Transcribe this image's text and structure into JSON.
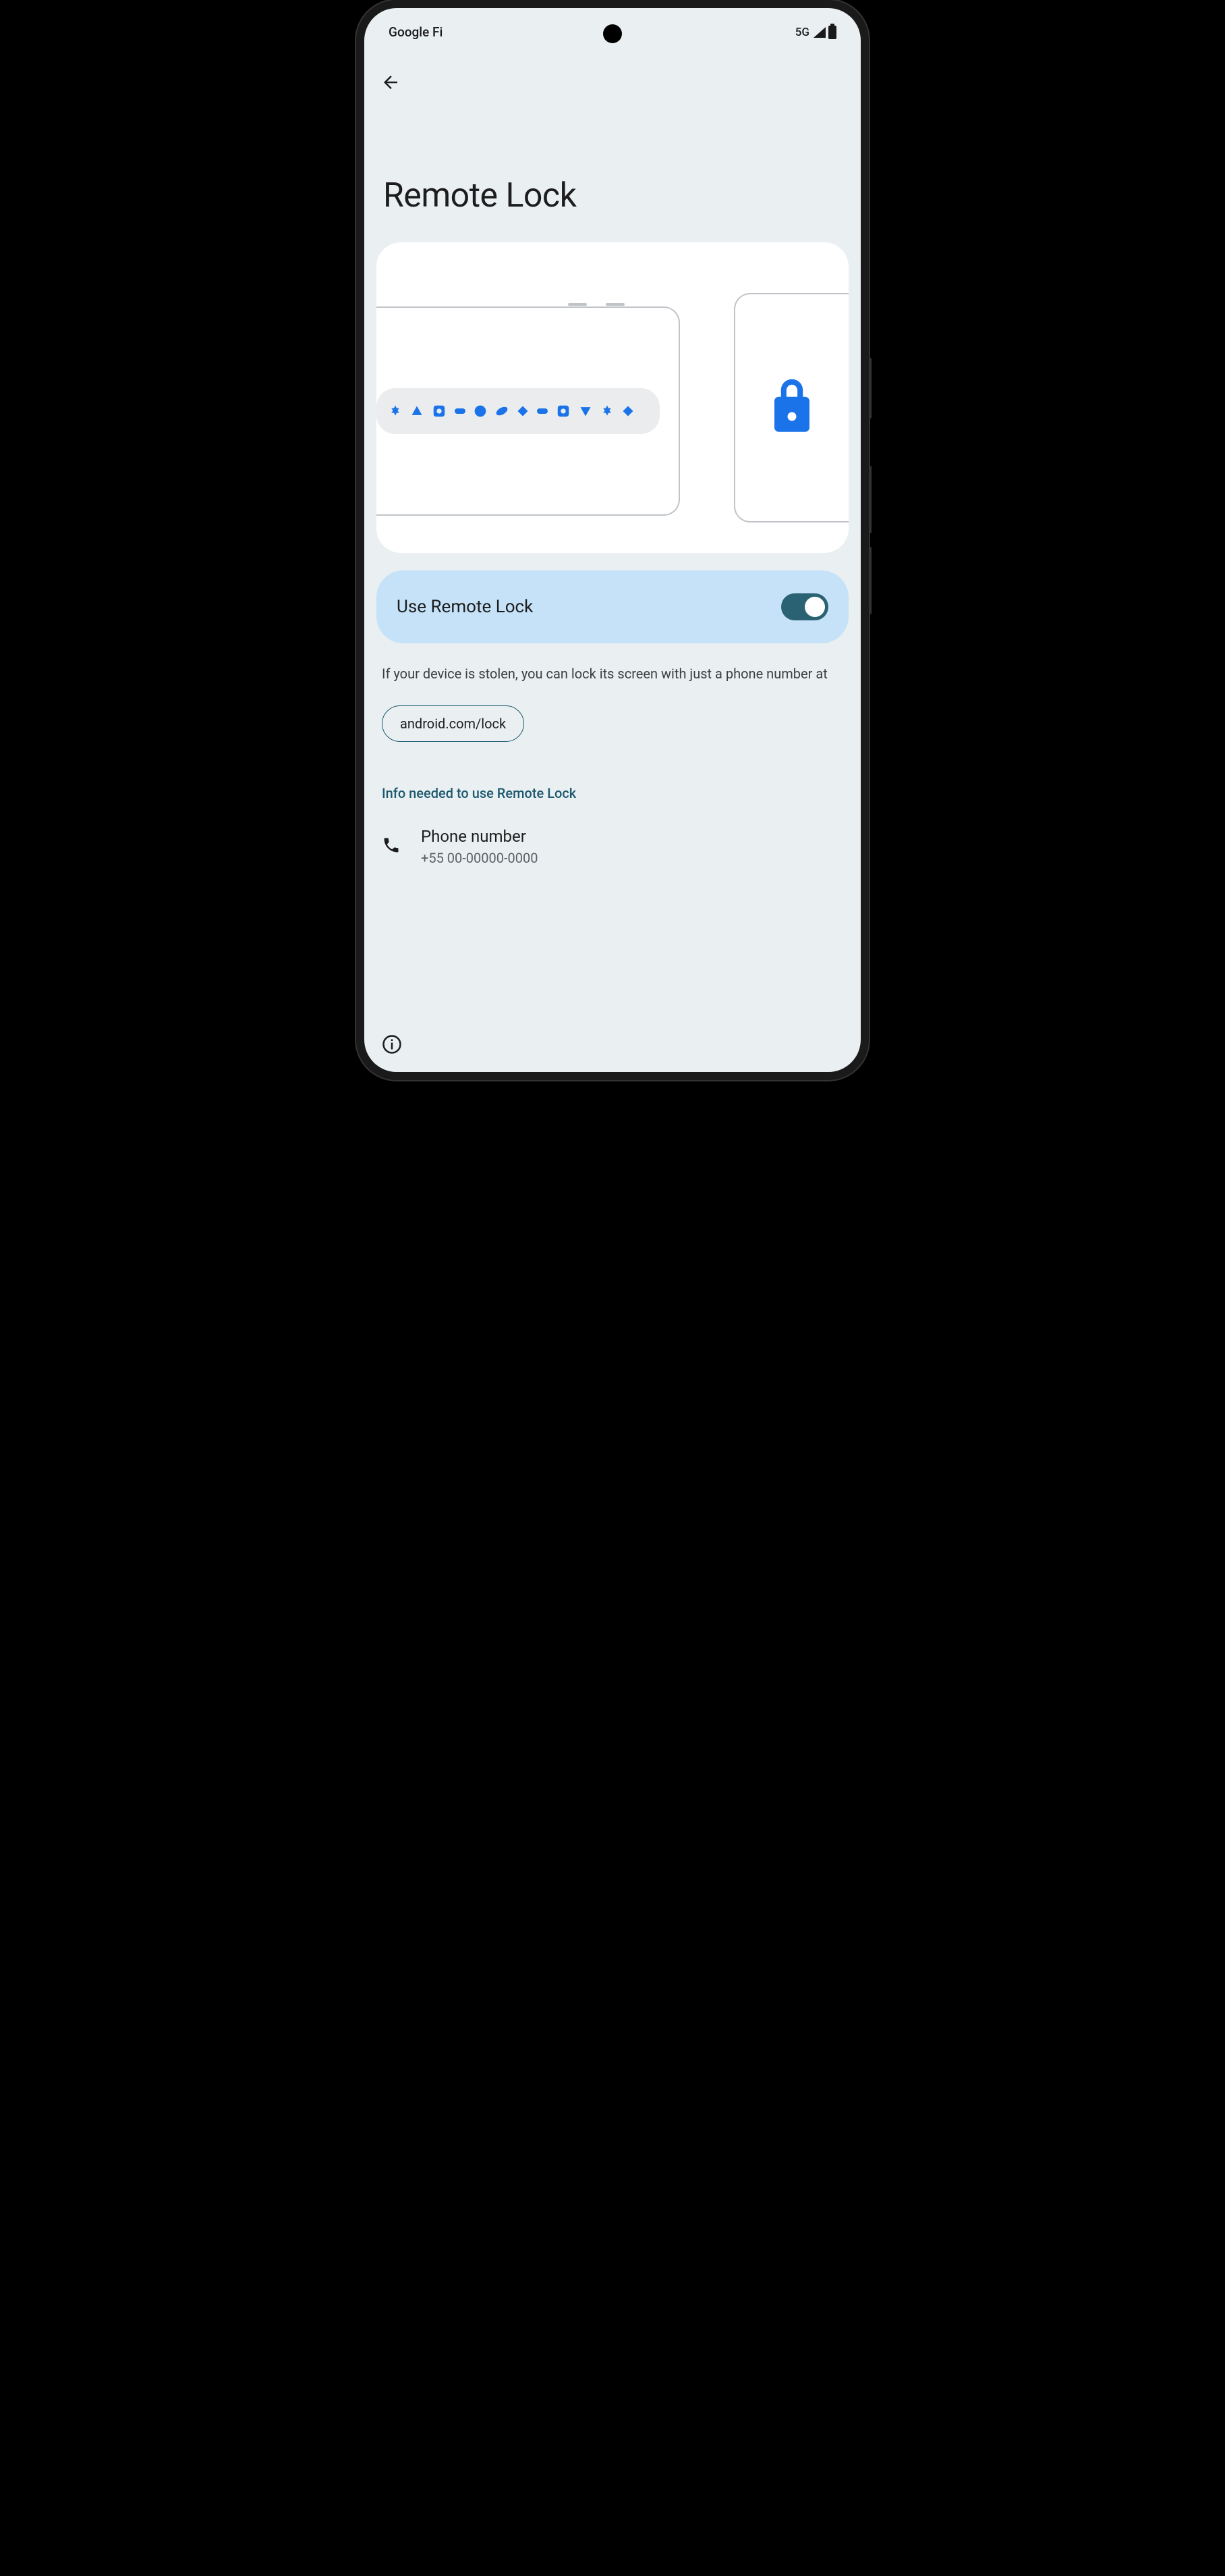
{
  "status": {
    "carrier": "Google Fi",
    "network": "5G"
  },
  "page": {
    "title": "Remote Lock"
  },
  "toggle": {
    "label": "Use Remote Lock",
    "state": "on"
  },
  "description": "If your device is stolen, you can lock its screen with just a phone number at",
  "url_chip": "android.com/lock",
  "section_header": "Info needed to use Remote Lock",
  "phone_item": {
    "title": "Phone number",
    "value": "+55 00-00000-0000"
  }
}
